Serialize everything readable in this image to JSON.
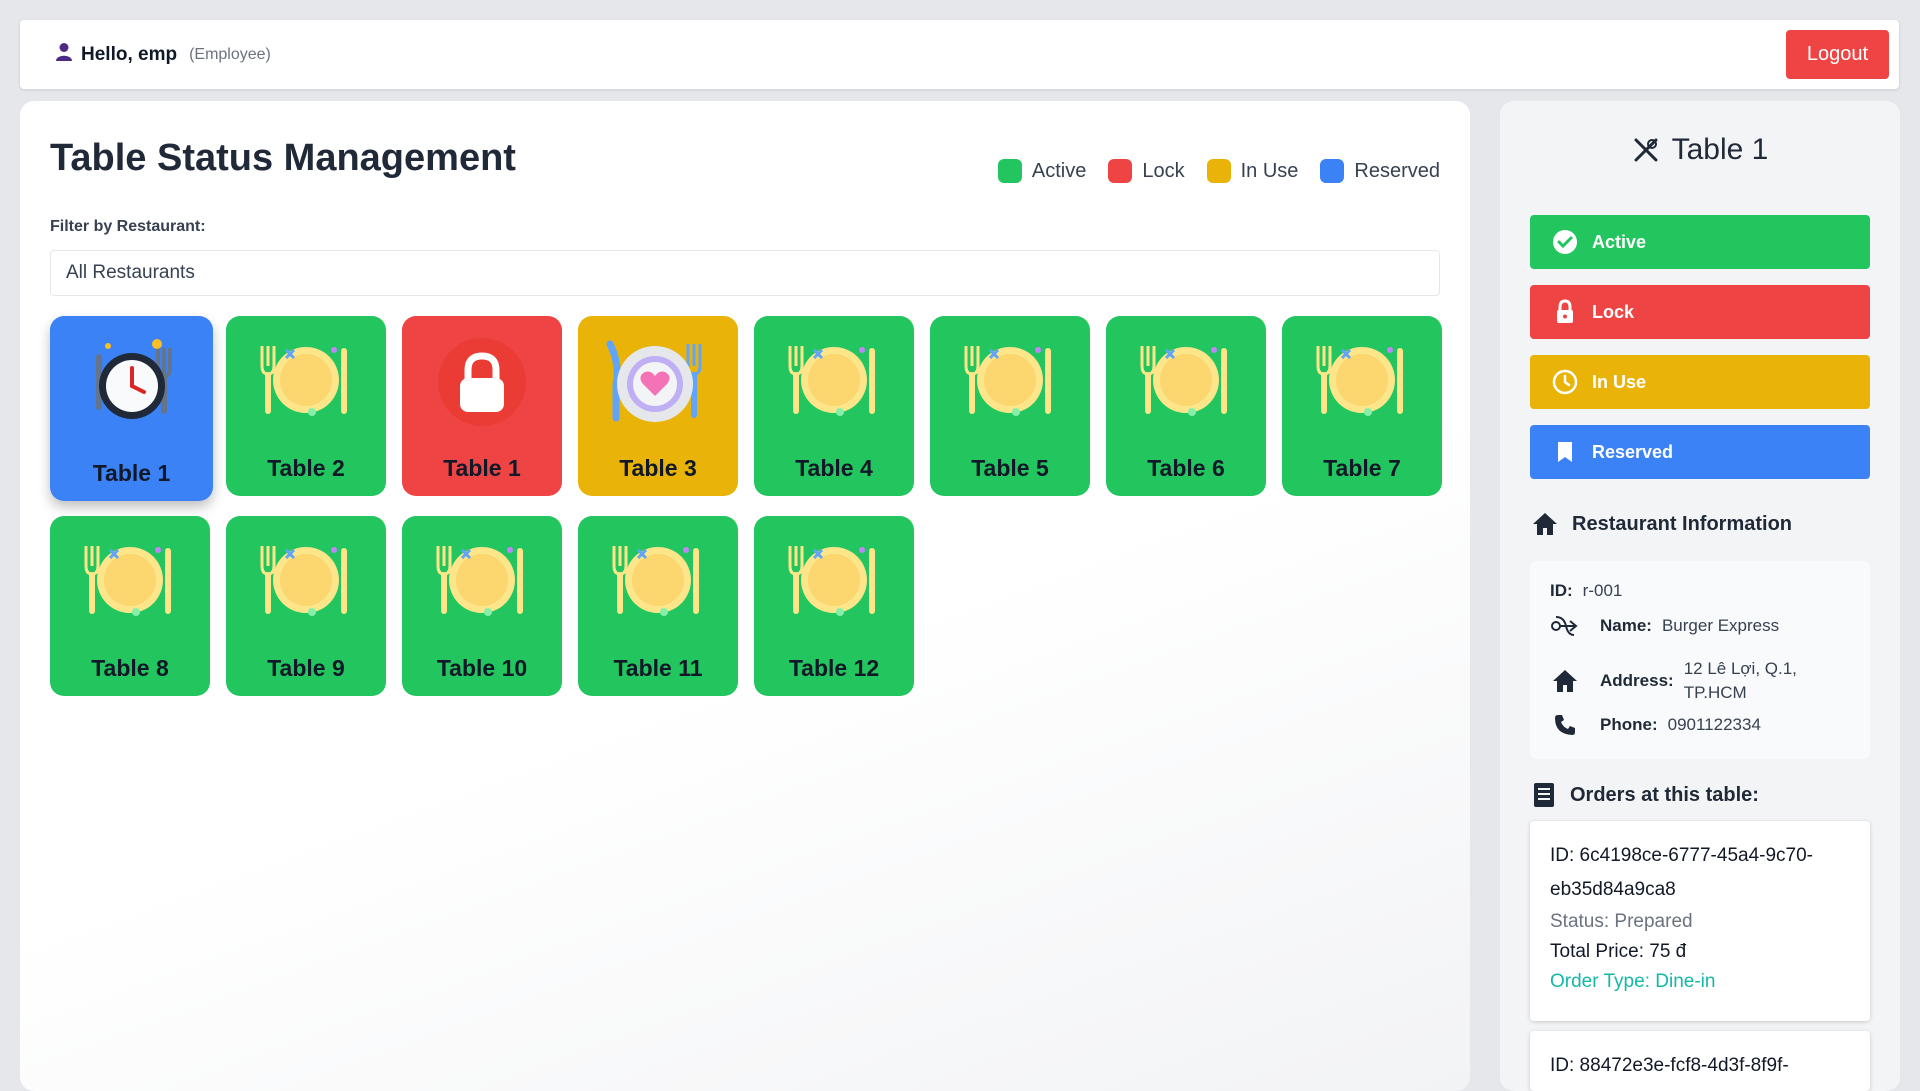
{
  "header": {
    "greeting": "Hello, emp",
    "role": "(Employee)",
    "logout_label": "Logout"
  },
  "main": {
    "title": "Table Status Management",
    "filter_label": "Filter by Restaurant:",
    "filter_value": "All Restaurants",
    "legend": [
      {
        "label": "Active",
        "color": "#22c55e"
      },
      {
        "label": "Lock",
        "color": "#ef4444"
      },
      {
        "label": "In Use",
        "color": "#eab308"
      },
      {
        "label": "Reserved",
        "color": "#3b82f6"
      }
    ],
    "tables": [
      {
        "label": "Table 1",
        "status": "Reserved",
        "icon": "clock-cutlery-icon"
      },
      {
        "label": "Table 2",
        "status": "Active",
        "icon": "plate-cutlery-icon"
      },
      {
        "label": "Table 1",
        "status": "Lock",
        "icon": "padlock-icon"
      },
      {
        "label": "Table 3",
        "status": "In Use",
        "icon": "plate-heart-icon"
      },
      {
        "label": "Table 4",
        "status": "Active",
        "icon": "plate-cutlery-icon"
      },
      {
        "label": "Table 5",
        "status": "Active",
        "icon": "plate-cutlery-icon"
      },
      {
        "label": "Table 6",
        "status": "Active",
        "icon": "plate-cutlery-icon"
      },
      {
        "label": "Table 7",
        "status": "Active",
        "icon": "plate-cutlery-icon"
      },
      {
        "label": "Table 8",
        "status": "Active",
        "icon": "plate-cutlery-icon"
      },
      {
        "label": "Table 9",
        "status": "Active",
        "icon": "plate-cutlery-icon"
      },
      {
        "label": "Table 10",
        "status": "Active",
        "icon": "plate-cutlery-icon"
      },
      {
        "label": "Table 11",
        "status": "Active",
        "icon": "plate-cutlery-icon"
      },
      {
        "label": "Table 12",
        "status": "Active",
        "icon": "plate-cutlery-icon"
      }
    ]
  },
  "side": {
    "title": "Table 1",
    "status_buttons": [
      {
        "label": "Active",
        "color": "#22c55e",
        "icon": "check-circle-icon"
      },
      {
        "label": "Lock",
        "color": "#ef4444",
        "icon": "lock-icon"
      },
      {
        "label": "In Use",
        "color": "#eab308",
        "icon": "clock-icon"
      },
      {
        "label": "Reserved",
        "color": "#3b82f6",
        "icon": "bookmark-icon"
      }
    ],
    "restaurant_heading": "Restaurant Information",
    "restaurant": {
      "id_label": "ID:",
      "id": "r-001",
      "name_label": "Name:",
      "name": "Burger Express",
      "address_label": "Address:",
      "address_line1": "12 Lê Lợi, Q.1,",
      "address_line2": "TP.HCM",
      "phone_label": "Phone:",
      "phone": "0901122334"
    },
    "orders_heading": "Orders at this table:",
    "orders": [
      {
        "id_line1": "ID: 6c4198ce-6777-45a4-9c70-",
        "id_line2": "eb35d84a9ca8",
        "status": "Status: Prepared",
        "price": "Total Price: 75 đ",
        "type": "Order Type: Dine-in"
      },
      {
        "id_line1": "ID: 88472e3e-fcf8-4d3f-8f9f-"
      }
    ]
  }
}
